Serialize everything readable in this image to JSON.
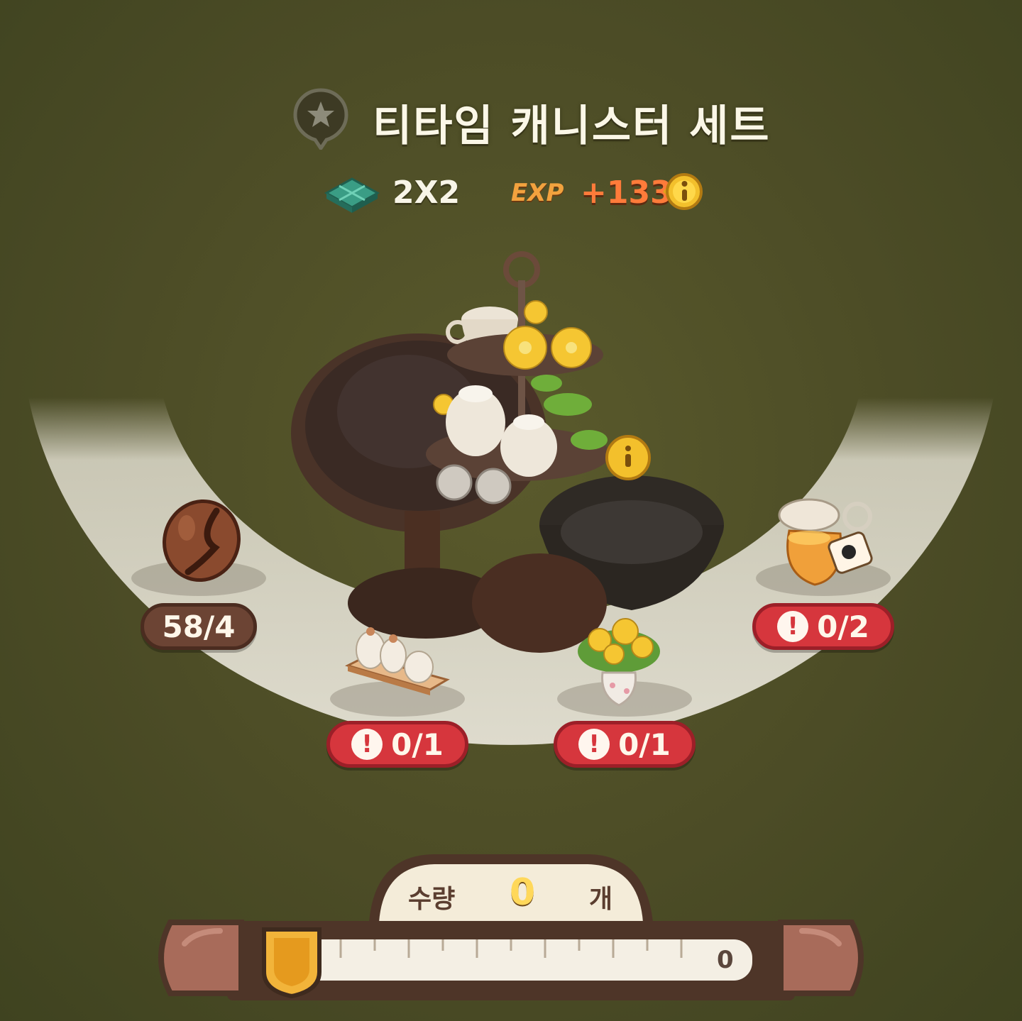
{
  "item": {
    "title": "티타임 캐니스터 세트",
    "size": "2X2",
    "exp_label": "EXP",
    "exp_value": "+133"
  },
  "materials": [
    {
      "name": "coffee-bean",
      "count": "58/4",
      "status": "enough"
    },
    {
      "name": "canister-tray",
      "count": "0/1",
      "status": "insufficient"
    },
    {
      "name": "flower-vase",
      "count": "0/1",
      "status": "insufficient"
    },
    {
      "name": "syrup-bottle",
      "count": "0/2",
      "status": "insufficient"
    }
  ],
  "quantity": {
    "label": "수량",
    "value": "0",
    "unit": "개",
    "slider_value": "0",
    "slider_fraction": 0
  },
  "colors": {
    "background": "#4c4c26",
    "warning_pill": "#d6363d",
    "ok_pill": "#6c4434",
    "exp_value": "#ff7b3a",
    "qty_value": "#ffd85a"
  },
  "icons": [
    "favorite-star-icon",
    "tile-size-icon",
    "info-coin-icon",
    "warning-icon",
    "slider-handle-icon"
  ]
}
